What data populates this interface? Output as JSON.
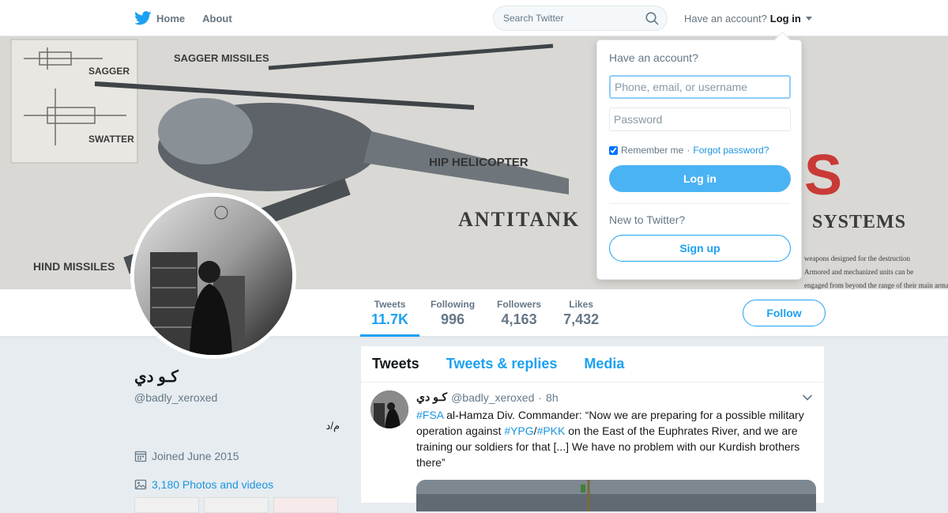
{
  "topbar": {
    "home_label": "Home",
    "about_label": "About",
    "search_placeholder": "Search Twitter",
    "have_account": "Have an account?",
    "login_label": "Log in"
  },
  "banner": {
    "labels": [
      "SAGGER",
      "SAGGER MISSILES",
      "SWATTER",
      "HIP HELICOPTER",
      "ANTITANK",
      "SYSTEMS",
      "HIND MISSILES",
      "S"
    ],
    "body_text": [
      "weapons designed for the destruction",
      "Armored and mechanized units can be",
      "engaged from beyond the range of their main armament by the Soviets"
    ]
  },
  "stats": [
    {
      "label": "Tweets",
      "value": "11.7K"
    },
    {
      "label": "Following",
      "value": "996"
    },
    {
      "label": "Followers",
      "value": "4,163"
    },
    {
      "label": "Likes",
      "value": "7,432"
    }
  ],
  "follow_label": "Follow",
  "profile": {
    "name": "كـو دي",
    "handle": "@badly_xeroxed",
    "bio": "م/د",
    "joined": "Joined June 2015",
    "photos": "3,180 Photos and videos"
  },
  "timeline": {
    "tabs": [
      "Tweets",
      "Tweets & replies",
      "Media"
    ],
    "tweet": {
      "name": "كـو دي",
      "handle": "@badly_xeroxed",
      "sep": "·",
      "time": "8h",
      "tag1": "#FSA",
      "text1": " al-Hamza Div. Commander: “Now we are preparing for a possible military operation against ",
      "tag2": "#YPG",
      "slash": "/",
      "tag3": "#PKK",
      "text2": " on the East of the Euphrates River, and we are training our soldiers for that [...] We have no problem with our Kurdish brothers there”"
    }
  },
  "login_dropdown": {
    "title": "Have an account?",
    "username_placeholder": "Phone, email, or username",
    "password_placeholder": "Password",
    "remember": "Remember me",
    "dot": "·",
    "forgot": "Forgot password?",
    "login_button": "Log in",
    "new_text": "New to Twitter?",
    "signup_button": "Sign up"
  },
  "colors": {
    "accent": "#1da1f2",
    "link": "#1b95e0",
    "background": "#e6ecf0"
  }
}
